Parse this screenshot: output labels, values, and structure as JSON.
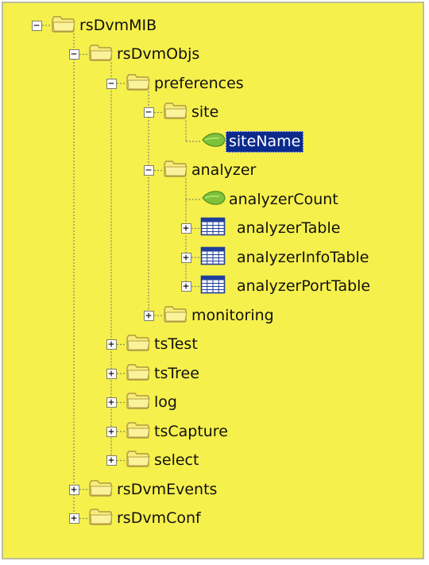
{
  "tree": [
    {
      "label": "rsDvmMIB",
      "level": 0,
      "icon": "folder-icon",
      "toggle": "minus"
    },
    {
      "label": "rsDvmObjs",
      "level": 1,
      "icon": "folder-icon",
      "toggle": "minus"
    },
    {
      "label": "preferences",
      "level": 2,
      "icon": "folder-icon",
      "toggle": "minus"
    },
    {
      "label": "site",
      "level": 3,
      "icon": "folder-icon",
      "toggle": "minus"
    },
    {
      "label": "siteName",
      "level": 4,
      "icon": "leaf-object-icon",
      "toggle": "none",
      "selected": true
    },
    {
      "label": "analyzer",
      "level": 3,
      "icon": "folder-icon",
      "toggle": "minus"
    },
    {
      "label": "analyzerCount",
      "level": 4,
      "icon": "leaf-object-icon",
      "toggle": "none"
    },
    {
      "label": "analyzerTable",
      "level": 4,
      "icon": "table-icon",
      "toggle": "plus"
    },
    {
      "label": "analyzerInfoTable",
      "level": 4,
      "icon": "table-icon",
      "toggle": "plus"
    },
    {
      "label": "analyzerPortTable",
      "level": 4,
      "icon": "table-icon",
      "toggle": "plus"
    },
    {
      "label": "monitoring",
      "level": 3,
      "icon": "folder-icon",
      "toggle": "plus"
    },
    {
      "label": "tsTest",
      "level": 2,
      "icon": "folder-icon",
      "toggle": "plus"
    },
    {
      "label": "tsTree",
      "level": 2,
      "icon": "folder-icon",
      "toggle": "plus"
    },
    {
      "label": "log",
      "level": 2,
      "icon": "folder-icon",
      "toggle": "plus"
    },
    {
      "label": "tsCapture",
      "level": 2,
      "icon": "folder-icon",
      "toggle": "plus"
    },
    {
      "label": "select",
      "level": 2,
      "icon": "folder-icon",
      "toggle": "plus"
    },
    {
      "label": "rsDvmEvents",
      "level": 1,
      "icon": "folder-icon",
      "toggle": "plus"
    },
    {
      "label": "rsDvmConf",
      "level": 1,
      "icon": "folder-icon",
      "toggle": "plus"
    }
  ],
  "colors": {
    "background": "#f6f04c",
    "folder": "#f7ec7a",
    "folder_edge": "#b09a40",
    "leaf": "#7ec23a",
    "table": "#1f3f9a",
    "selection": "#0b2a8c",
    "line": "#8a8a70"
  }
}
